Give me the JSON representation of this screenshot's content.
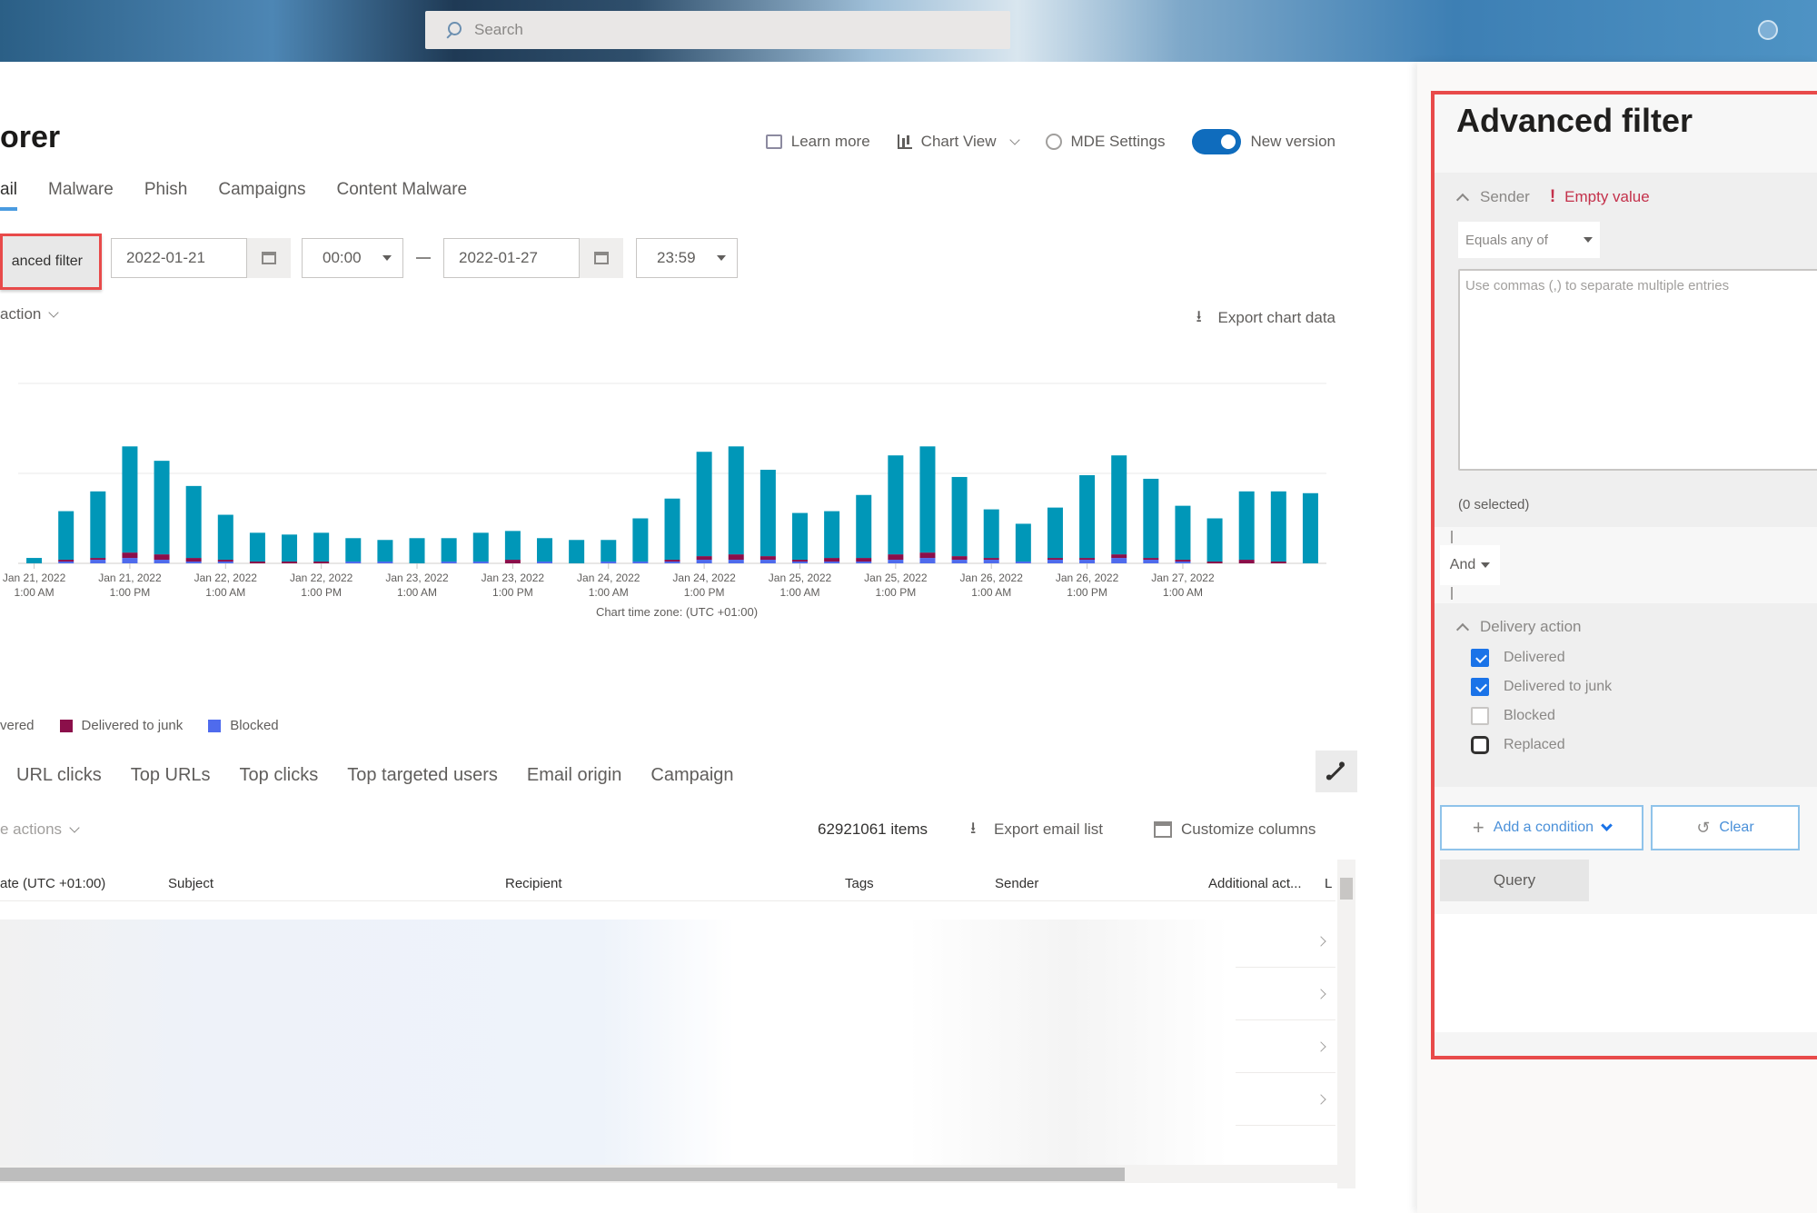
{
  "header": {
    "search_placeholder": "Search"
  },
  "page": {
    "title": "orer",
    "top_actions": {
      "learn_more": "Learn more",
      "chart_view": "Chart View",
      "mde_settings": "MDE Settings",
      "new_version": "New version",
      "new_version_on": true
    },
    "tabs": [
      {
        "label": "ail",
        "active": true
      },
      {
        "label": "Malware",
        "active": false
      },
      {
        "label": "Phish",
        "active": false
      },
      {
        "label": "Campaigns",
        "active": false
      },
      {
        "label": "Content Malware",
        "active": false
      }
    ],
    "filter": {
      "advanced_filter_label": "anced filter",
      "start_date": "2022-01-21",
      "start_time": "00:00",
      "end_date": "2022-01-27",
      "end_time": "23:59"
    },
    "pivot_dropdown": "action",
    "export_chart_data": "Export chart data",
    "legend": [
      {
        "label": "vered",
        "color": "#0097b8"
      },
      {
        "label": "Delivered to junk",
        "color": "#8b0f4a"
      },
      {
        "label": "Blocked",
        "color": "#4f6bed"
      }
    ],
    "subtabs": [
      "URL clicks",
      "Top URLs",
      "Top clicks",
      "Top targeted users",
      "Email origin",
      "Campaign"
    ],
    "list": {
      "take_actions": "e actions",
      "items_count": "62921061 items",
      "export_email_list": "Export email list",
      "customize_columns": "Customize columns",
      "columns": [
        "ate (UTC +01:00)",
        "Subject",
        "Recipient",
        "Tags",
        "Sender",
        "Additional act...",
        "L"
      ]
    }
  },
  "chart_data": {
    "type": "bar",
    "stacked": true,
    "title": "",
    "xlabel": "Chart time zone: (UTC +01:00)",
    "ylabel": "",
    "grid": true,
    "ylim": [
      0,
      100
    ],
    "y_unit_note": "relative scale (no y-axis labels visible); middle gridline = 50, top gridline = 100",
    "tick_labels": [
      {
        "index": 1,
        "line1": "Jan 21, 2022",
        "line2": "1:00 AM"
      },
      {
        "index": 7,
        "line1": "Jan 21, 2022",
        "line2": "1:00 PM"
      },
      {
        "index": 13,
        "line1": "Jan 22, 2022",
        "line2": "1:00 AM"
      },
      {
        "index": 19,
        "line1": "Jan 22, 2022",
        "line2": "1:00 PM"
      },
      {
        "index": 25,
        "line1": "Jan 23, 2022",
        "line2": "1:00 AM"
      },
      {
        "index": 31,
        "line1": "Jan 23, 2022",
        "line2": "1:00 PM"
      },
      {
        "index": 37,
        "line1": "Jan 24, 2022",
        "line2": "1:00 AM"
      },
      {
        "index": 43,
        "line1": "Jan 24, 2022",
        "line2": "1:00 PM"
      },
      {
        "index": 49,
        "line1": "Jan 25, 2022",
        "line2": "1:00 AM"
      },
      {
        "index": 55,
        "line1": "Jan 25, 2022",
        "line2": "1:00 PM"
      },
      {
        "index": 61,
        "line1": "Jan 26, 2022",
        "line2": "1:00 AM"
      },
      {
        "index": 67,
        "line1": "Jan 26, 2022",
        "line2": "1:00 PM"
      },
      {
        "index": 73,
        "line1": "Jan 27, 2022",
        "line2": "1:00 AM"
      }
    ],
    "x_count": 82,
    "bar_indices": [
      1,
      3,
      5,
      7,
      9,
      11,
      13,
      15,
      17,
      19,
      21,
      23,
      25,
      27,
      29,
      31,
      33,
      35,
      37,
      39,
      41,
      43,
      45,
      47,
      49,
      51,
      53,
      55,
      57,
      59,
      61,
      63,
      65,
      67,
      69,
      71,
      73,
      75,
      77,
      79,
      81
    ],
    "series": [
      {
        "name": "Delivered",
        "color": "#0097b8",
        "values": [
          3,
          27,
          37,
          59,
          52,
          40,
          25,
          16,
          15,
          16,
          13,
          12,
          14,
          13,
          16,
          16,
          13,
          13,
          12,
          24,
          34,
          58,
          60,
          48,
          26,
          26,
          35,
          55,
          59,
          44,
          27,
          21,
          28,
          46,
          55,
          44,
          30,
          24,
          38,
          39,
          39
        ]
      },
      {
        "name": "Delivered to junk",
        "color": "#8b0f4a",
        "values": [
          0,
          1,
          1,
          3,
          3,
          2,
          1,
          1,
          1,
          1,
          0,
          0,
          0,
          0,
          0,
          2,
          0,
          0,
          0,
          0,
          1,
          2,
          3,
          2,
          1,
          2,
          2,
          3,
          3,
          2,
          1,
          0,
          1,
          1,
          2,
          1,
          1,
          1,
          2,
          1,
          0
        ]
      },
      {
        "name": "Blocked",
        "color": "#4f6bed",
        "values": [
          0,
          1,
          2,
          3,
          2,
          1,
          1,
          0,
          0,
          0,
          1,
          1,
          0,
          1,
          1,
          0,
          1,
          0,
          1,
          1,
          1,
          2,
          2,
          2,
          1,
          1,
          1,
          2,
          3,
          2,
          2,
          1,
          2,
          2,
          3,
          2,
          1,
          0,
          0,
          0,
          0
        ]
      }
    ]
  },
  "advanced_filter": {
    "title": "Advanced filter",
    "sender": {
      "label": "Sender",
      "error": "Empty value",
      "operator": "Equals any of",
      "placeholder": "Use commas (,) to separate multiple entries",
      "selected_count": "(0 selected)"
    },
    "join_operator": "And",
    "delivery_action": {
      "label": "Delivery action",
      "options": [
        {
          "label": "Delivered",
          "checked": true
        },
        {
          "label": "Delivered to junk",
          "checked": true
        },
        {
          "label": "Blocked",
          "checked": false
        },
        {
          "label": "Replaced",
          "checked": false
        }
      ]
    },
    "add_condition": "Add a condition",
    "clear": "Clear",
    "query": "Query"
  }
}
